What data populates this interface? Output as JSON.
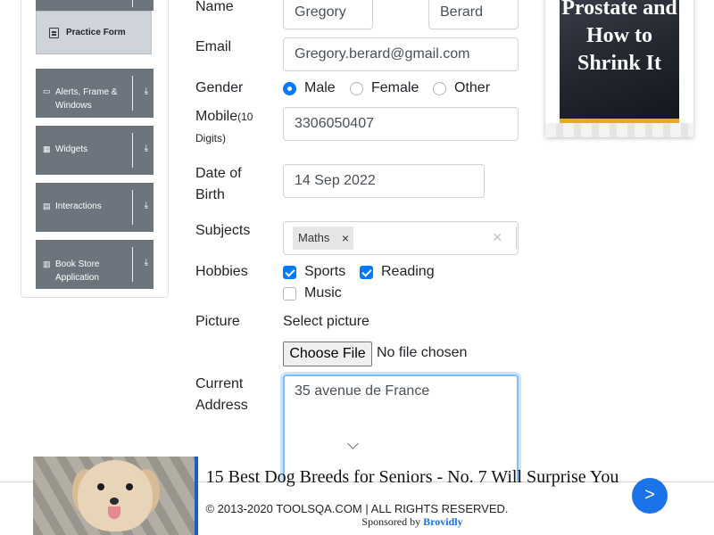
{
  "sidebar": {
    "active_item": {
      "label": "Practice Form",
      "icon": "form-icon"
    },
    "groups": [
      {
        "label": "Alerts, Frame & Windows",
        "icon": "window-icon",
        "arrow": "download-arrow-icon"
      },
      {
        "label": "Widgets",
        "icon": "widgets-icon",
        "arrow": "download-arrow-icon"
      },
      {
        "label": "Interactions",
        "icon": "interactions-icon",
        "arrow": "download-arrow-icon"
      },
      {
        "label": "Book Store Application",
        "icon": "book-icon",
        "arrow": "download-arrow-icon"
      }
    ]
  },
  "form": {
    "name": {
      "label": "Name",
      "first": "Gregory",
      "last": "Berard"
    },
    "email": {
      "label": "Email",
      "value": "Gregory.berard@gmail.com"
    },
    "gender": {
      "label": "Gender",
      "options": [
        "Male",
        "Female",
        "Other"
      ],
      "selected": "Male"
    },
    "mobile": {
      "label": "Mobile",
      "hint": "(10 Digits)",
      "value": "3306050407"
    },
    "dob": {
      "label_line1": "Date of",
      "label_line2": "Birth",
      "value": "14 Sep 2022"
    },
    "subjects": {
      "label": "Subjects",
      "chips": [
        "Maths"
      ],
      "remove_glyph": "×",
      "clear_glyph": "×"
    },
    "hobbies": {
      "label": "Hobbies",
      "options": [
        {
          "label": "Sports",
          "checked": true
        },
        {
          "label": "Reading",
          "checked": true
        },
        {
          "label": "Music",
          "checked": false
        }
      ]
    },
    "picture": {
      "label": "Picture",
      "prompt": "Select picture",
      "button": "Choose File",
      "status": "No file chosen"
    },
    "address": {
      "label_line1": "Current",
      "label_line2": "Address",
      "value": "35 avenue de France"
    }
  },
  "ad_right": {
    "headline": "Prostate and How to Shrink It"
  },
  "ad_bottom": {
    "title": "15 Best Dog Breeds for Seniors - No. 7 Will Surprise You",
    "sponsored_prefix": "Sponsored by",
    "brand": "Brovidly",
    "next": ">"
  },
  "footer": {
    "text": "© 2013-2020 TOOLSQA.COM | ALL RIGHTS RESERVED."
  },
  "colors": {
    "accent": "#007bff",
    "sidebar_group": "#6c757d",
    "ad_accent": "#1a73e8"
  }
}
